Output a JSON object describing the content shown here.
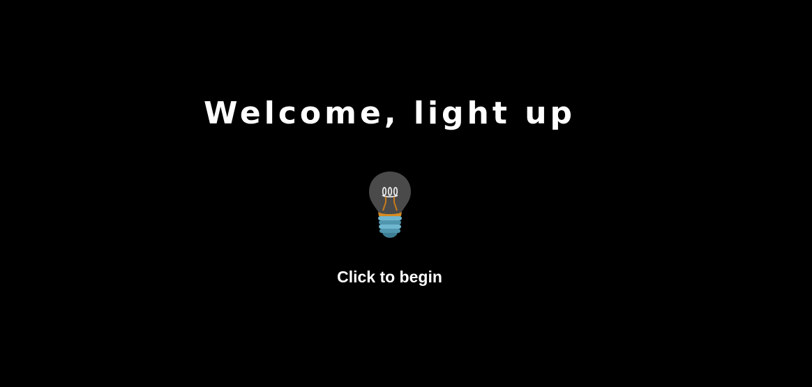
{
  "page": {
    "background": "#000000",
    "text_color": "#ffffff"
  },
  "hero": {
    "title": "Welcome, light up",
    "subtitle": "Click to begin",
    "icon": "light-bulb-icon",
    "bulb_state": "off"
  },
  "colors": {
    "bulb_glass": "#4a4a4a",
    "filament": "#e8e8e8",
    "filament_wire": "#c77a1a",
    "base": "#5fa9c2"
  }
}
